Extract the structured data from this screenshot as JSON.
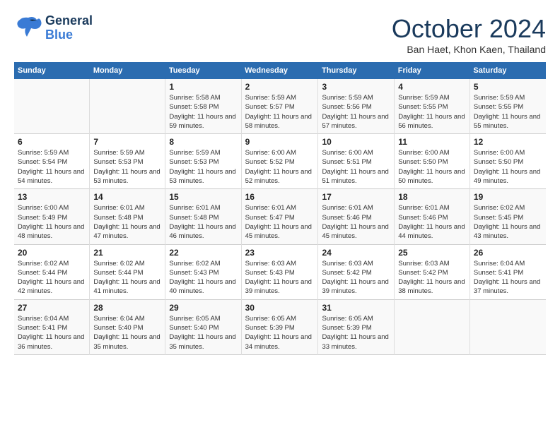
{
  "header": {
    "logo": {
      "line1": "General",
      "line2": "Blue"
    },
    "title": "October 2024",
    "location": "Ban Haet, Khon Kaen, Thailand"
  },
  "columns": [
    "Sunday",
    "Monday",
    "Tuesday",
    "Wednesday",
    "Thursday",
    "Friday",
    "Saturday"
  ],
  "weeks": [
    [
      {
        "day": "",
        "info": ""
      },
      {
        "day": "",
        "info": ""
      },
      {
        "day": "1",
        "info": "Sunrise: 5:58 AM\nSunset: 5:58 PM\nDaylight: 11 hours\nand 59 minutes."
      },
      {
        "day": "2",
        "info": "Sunrise: 5:59 AM\nSunset: 5:57 PM\nDaylight: 11 hours\nand 58 minutes."
      },
      {
        "day": "3",
        "info": "Sunrise: 5:59 AM\nSunset: 5:56 PM\nDaylight: 11 hours\nand 57 minutes."
      },
      {
        "day": "4",
        "info": "Sunrise: 5:59 AM\nSunset: 5:55 PM\nDaylight: 11 hours\nand 56 minutes."
      },
      {
        "day": "5",
        "info": "Sunrise: 5:59 AM\nSunset: 5:55 PM\nDaylight: 11 hours\nand 55 minutes."
      }
    ],
    [
      {
        "day": "6",
        "info": "Sunrise: 5:59 AM\nSunset: 5:54 PM\nDaylight: 11 hours\nand 54 minutes."
      },
      {
        "day": "7",
        "info": "Sunrise: 5:59 AM\nSunset: 5:53 PM\nDaylight: 11 hours\nand 53 minutes."
      },
      {
        "day": "8",
        "info": "Sunrise: 5:59 AM\nSunset: 5:53 PM\nDaylight: 11 hours\nand 53 minutes."
      },
      {
        "day": "9",
        "info": "Sunrise: 6:00 AM\nSunset: 5:52 PM\nDaylight: 11 hours\nand 52 minutes."
      },
      {
        "day": "10",
        "info": "Sunrise: 6:00 AM\nSunset: 5:51 PM\nDaylight: 11 hours\nand 51 minutes."
      },
      {
        "day": "11",
        "info": "Sunrise: 6:00 AM\nSunset: 5:50 PM\nDaylight: 11 hours\nand 50 minutes."
      },
      {
        "day": "12",
        "info": "Sunrise: 6:00 AM\nSunset: 5:50 PM\nDaylight: 11 hours\nand 49 minutes."
      }
    ],
    [
      {
        "day": "13",
        "info": "Sunrise: 6:00 AM\nSunset: 5:49 PM\nDaylight: 11 hours\nand 48 minutes."
      },
      {
        "day": "14",
        "info": "Sunrise: 6:01 AM\nSunset: 5:48 PM\nDaylight: 11 hours\nand 47 minutes."
      },
      {
        "day": "15",
        "info": "Sunrise: 6:01 AM\nSunset: 5:48 PM\nDaylight: 11 hours\nand 46 minutes."
      },
      {
        "day": "16",
        "info": "Sunrise: 6:01 AM\nSunset: 5:47 PM\nDaylight: 11 hours\nand 45 minutes."
      },
      {
        "day": "17",
        "info": "Sunrise: 6:01 AM\nSunset: 5:46 PM\nDaylight: 11 hours\nand 45 minutes."
      },
      {
        "day": "18",
        "info": "Sunrise: 6:01 AM\nSunset: 5:46 PM\nDaylight: 11 hours\nand 44 minutes."
      },
      {
        "day": "19",
        "info": "Sunrise: 6:02 AM\nSunset: 5:45 PM\nDaylight: 11 hours\nand 43 minutes."
      }
    ],
    [
      {
        "day": "20",
        "info": "Sunrise: 6:02 AM\nSunset: 5:44 PM\nDaylight: 11 hours\nand 42 minutes."
      },
      {
        "day": "21",
        "info": "Sunrise: 6:02 AM\nSunset: 5:44 PM\nDaylight: 11 hours\nand 41 minutes."
      },
      {
        "day": "22",
        "info": "Sunrise: 6:02 AM\nSunset: 5:43 PM\nDaylight: 11 hours\nand 40 minutes."
      },
      {
        "day": "23",
        "info": "Sunrise: 6:03 AM\nSunset: 5:43 PM\nDaylight: 11 hours\nand 39 minutes."
      },
      {
        "day": "24",
        "info": "Sunrise: 6:03 AM\nSunset: 5:42 PM\nDaylight: 11 hours\nand 39 minutes."
      },
      {
        "day": "25",
        "info": "Sunrise: 6:03 AM\nSunset: 5:42 PM\nDaylight: 11 hours\nand 38 minutes."
      },
      {
        "day": "26",
        "info": "Sunrise: 6:04 AM\nSunset: 5:41 PM\nDaylight: 11 hours\nand 37 minutes."
      }
    ],
    [
      {
        "day": "27",
        "info": "Sunrise: 6:04 AM\nSunset: 5:41 PM\nDaylight: 11 hours\nand 36 minutes."
      },
      {
        "day": "28",
        "info": "Sunrise: 6:04 AM\nSunset: 5:40 PM\nDaylight: 11 hours\nand 35 minutes."
      },
      {
        "day": "29",
        "info": "Sunrise: 6:05 AM\nSunset: 5:40 PM\nDaylight: 11 hours\nand 35 minutes."
      },
      {
        "day": "30",
        "info": "Sunrise: 6:05 AM\nSunset: 5:39 PM\nDaylight: 11 hours\nand 34 minutes."
      },
      {
        "day": "31",
        "info": "Sunrise: 6:05 AM\nSunset: 5:39 PM\nDaylight: 11 hours\nand 33 minutes."
      },
      {
        "day": "",
        "info": ""
      },
      {
        "day": "",
        "info": ""
      }
    ]
  ]
}
